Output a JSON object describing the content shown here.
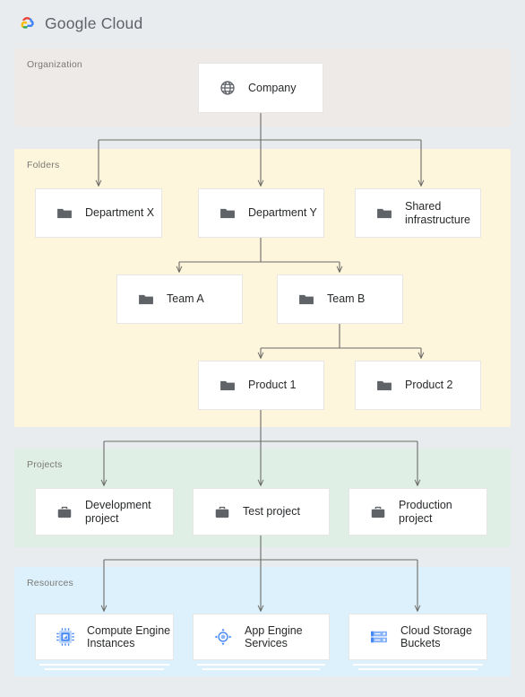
{
  "brand": {
    "name_part1": "Google",
    "name_part2": "Cloud",
    "logo_icon": "google-cloud-logo-icon"
  },
  "layers": [
    {
      "id": "organization",
      "label": "Organization",
      "color": "#edeae8"
    },
    {
      "id": "folders",
      "label": "Folders",
      "color": "#fdf6dd"
    },
    {
      "id": "projects",
      "label": "Projects",
      "color": "#e0efe6"
    },
    {
      "id": "resources",
      "label": "Resources",
      "color": "#ddf1fd"
    }
  ],
  "nodes": {
    "company": {
      "label": "Company",
      "icon": "globe-icon"
    },
    "department_x": {
      "label": "Department X",
      "icon": "folder-icon"
    },
    "department_y": {
      "label": "Department Y",
      "icon": "folder-icon"
    },
    "shared_infra": {
      "label": "Shared\ninfrastructure",
      "icon": "folder-icon"
    },
    "team_a": {
      "label": "Team A",
      "icon": "folder-icon"
    },
    "team_b": {
      "label": "Team B",
      "icon": "folder-icon"
    },
    "product_1": {
      "label": "Product 1",
      "icon": "folder-icon"
    },
    "product_2": {
      "label": "Product 2",
      "icon": "folder-icon"
    },
    "dev_project": {
      "label": "Development\nproject",
      "icon": "briefcase-icon"
    },
    "test_project": {
      "label": "Test project",
      "icon": "briefcase-icon"
    },
    "prod_project": {
      "label": "Production\nproject",
      "icon": "briefcase-icon"
    },
    "compute_engine": {
      "label": "Compute Engine\nInstances",
      "icon": "cpu-chip-icon"
    },
    "app_engine": {
      "label": "App Engine\nServices",
      "icon": "app-engine-icon"
    },
    "cloud_storage": {
      "label": "Cloud Storage\nBuckets",
      "icon": "storage-buckets-icon"
    }
  },
  "colors": {
    "page_background": "#e8ecef",
    "card_background": "#ffffff",
    "card_border": "#e6e6e6",
    "connector": "#6b6b66",
    "label_text": "#7a7a74",
    "node_text": "#27292b",
    "gray_icon": "#5f6368",
    "blue_icon": "#4285f4",
    "blue_icon_light": "#8ab4f8"
  },
  "hierarchy": [
    {
      "from": "company",
      "to": [
        "department_x",
        "department_y",
        "shared_infra"
      ]
    },
    {
      "from": "department_y",
      "to": [
        "team_a",
        "team_b"
      ]
    },
    {
      "from": "team_b",
      "to": [
        "product_1",
        "product_2"
      ]
    },
    {
      "from": "product_1",
      "to": [
        "dev_project",
        "test_project",
        "prod_project"
      ]
    },
    {
      "from": "test_project",
      "to": [
        "compute_engine",
        "app_engine",
        "cloud_storage"
      ]
    }
  ]
}
